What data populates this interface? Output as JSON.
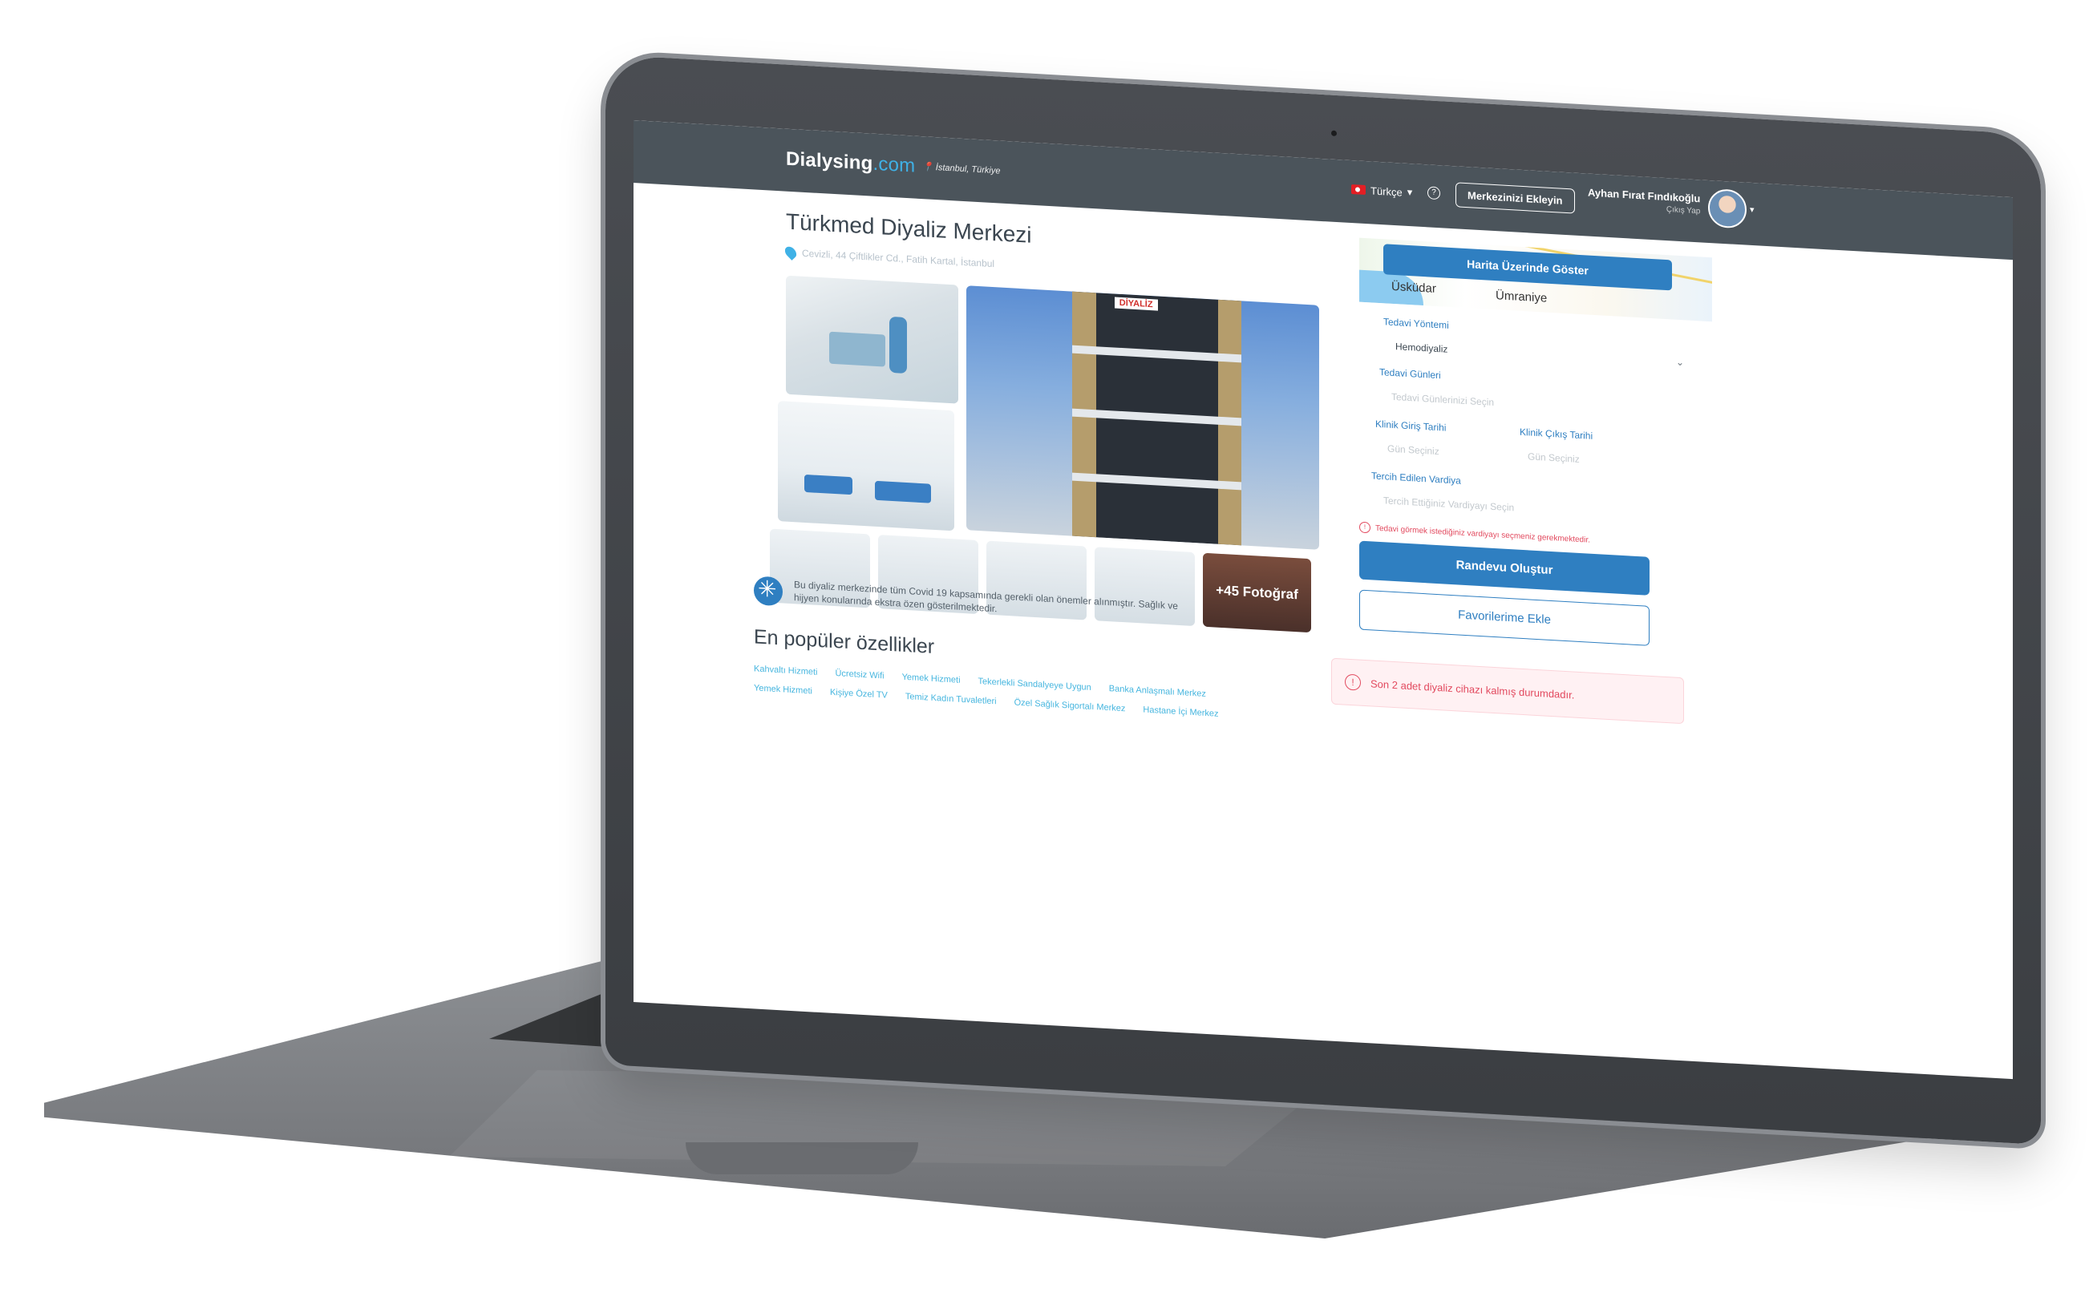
{
  "header": {
    "brand_name": "Dialysing",
    "brand_tld": ".com",
    "location": "İstanbul, Türkiye",
    "language": "Türkçe",
    "add_center_label": "Merkezinizi Ekleyin",
    "user_name": "Ayhan Fırat Fındıkoğlu",
    "logout_label": "Çıkış Yap"
  },
  "center": {
    "title": "Türkmed Diyaliz Merkezi",
    "address": "Cevizli, 44 Çiftlikler Cd., Fatih Kartal, İstanbul",
    "building_sign": "DİYALİZ",
    "more_photos_label": "+45 Fotoğraf"
  },
  "covid_note": "Bu diyaliz merkezinde tüm Covid 19 kapsamında gerekli olan önemler alınmıştır. Sağlık ve hijyen konularında ekstra özen gösterilmektedir.",
  "features": {
    "title": "En popüler özellikler",
    "items": [
      "Kahvaltı Hizmeti",
      "Ücretsiz Wifi",
      "Yemek Hizmeti",
      "Tekerlekli Sandalyeye Uygun",
      "Banka Anlaşmalı Merkez",
      "Yemek Hizmeti",
      "Kişiye Özel TV",
      "Temiz Kadın Tuvaletleri",
      "Özel Sağlık Sigortalı Merkez",
      "Hastane İçi Merkez"
    ]
  },
  "sidebar": {
    "map_button_label": "Harita Üzerinde Göster",
    "map_label_1": "Üsküdar",
    "map_label_2": "Ümraniye",
    "treatment_method_label": "Tedavi Yöntemi",
    "treatment_method_value": "Hemodiyaliz",
    "treatment_days_label": "Tedavi Günleri",
    "treatment_days_placeholder": "Tedavi Günlerinizi Seçin",
    "checkin_label": "Klinik Giriş Tarihi",
    "checkout_label": "Klinik Çıkış Tarihi",
    "checkin_placeholder": "Gün Seçiniz",
    "checkout_placeholder": "Gün Seçiniz",
    "shift_label": "Tercih Edilen Vardiya",
    "shift_placeholder": "Tercih Ettiğiniz Vardiyayı Seçin",
    "warning": "Tedavi görmek istediğiniz vardiyayı seçmeniz gerekmektedir.",
    "create_appointment_label": "Randevu Oluştur",
    "add_favorites_label": "Favorilerime Ekle",
    "availability_alert": "Son 2 adet diyaliz cihazı kalmış durumdadır."
  },
  "colors": {
    "topbar": "#4b545b",
    "primary": "#2f7fc1",
    "accent": "#3fb1e6",
    "alert": "#e24a5f"
  }
}
